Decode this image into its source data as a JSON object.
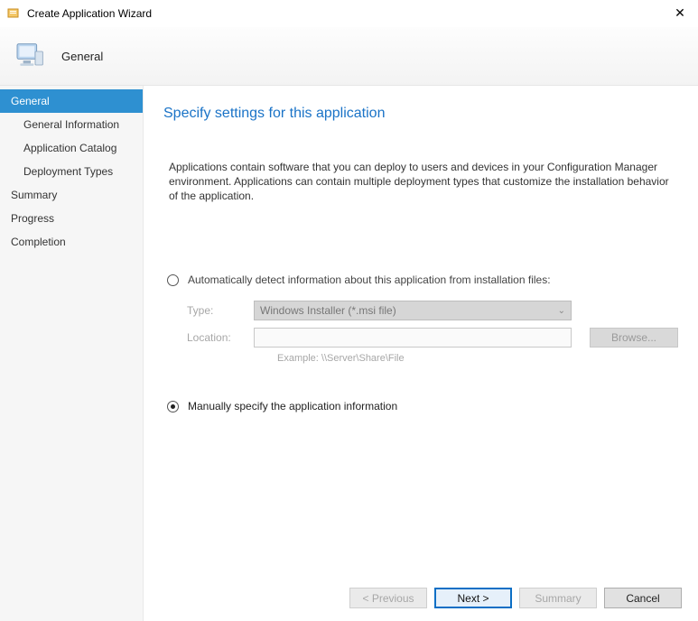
{
  "window": {
    "title": "Create Application Wizard",
    "close_glyph": "✕"
  },
  "header": {
    "step_label": "General"
  },
  "sidebar": {
    "items": [
      {
        "label": "General",
        "active": true,
        "sub": false
      },
      {
        "label": "General Information",
        "active": false,
        "sub": true
      },
      {
        "label": "Application Catalog",
        "active": false,
        "sub": true
      },
      {
        "label": "Deployment Types",
        "active": false,
        "sub": true
      },
      {
        "label": "Summary",
        "active": false,
        "sub": false
      },
      {
        "label": "Progress",
        "active": false,
        "sub": false
      },
      {
        "label": "Completion",
        "active": false,
        "sub": false
      }
    ]
  },
  "main": {
    "heading": "Specify settings for this application",
    "intro": "Applications contain software that you can deploy to users and devices in your Configuration Manager environment. Applications can contain multiple deployment types that customize the installation behavior of the application.",
    "radio_auto_label": "Automatically detect information about this application from installation files:",
    "radio_manual_label": "Manually specify the application information",
    "form": {
      "type_label": "Type:",
      "type_value": "Windows Installer (*.msi file)",
      "location_label": "Location:",
      "location_value": "",
      "browse_label": "Browse...",
      "example_text": "Example: \\\\Server\\Share\\File"
    }
  },
  "footer": {
    "previous": "< Previous",
    "next": "Next >",
    "summary": "Summary",
    "cancel": "Cancel"
  }
}
